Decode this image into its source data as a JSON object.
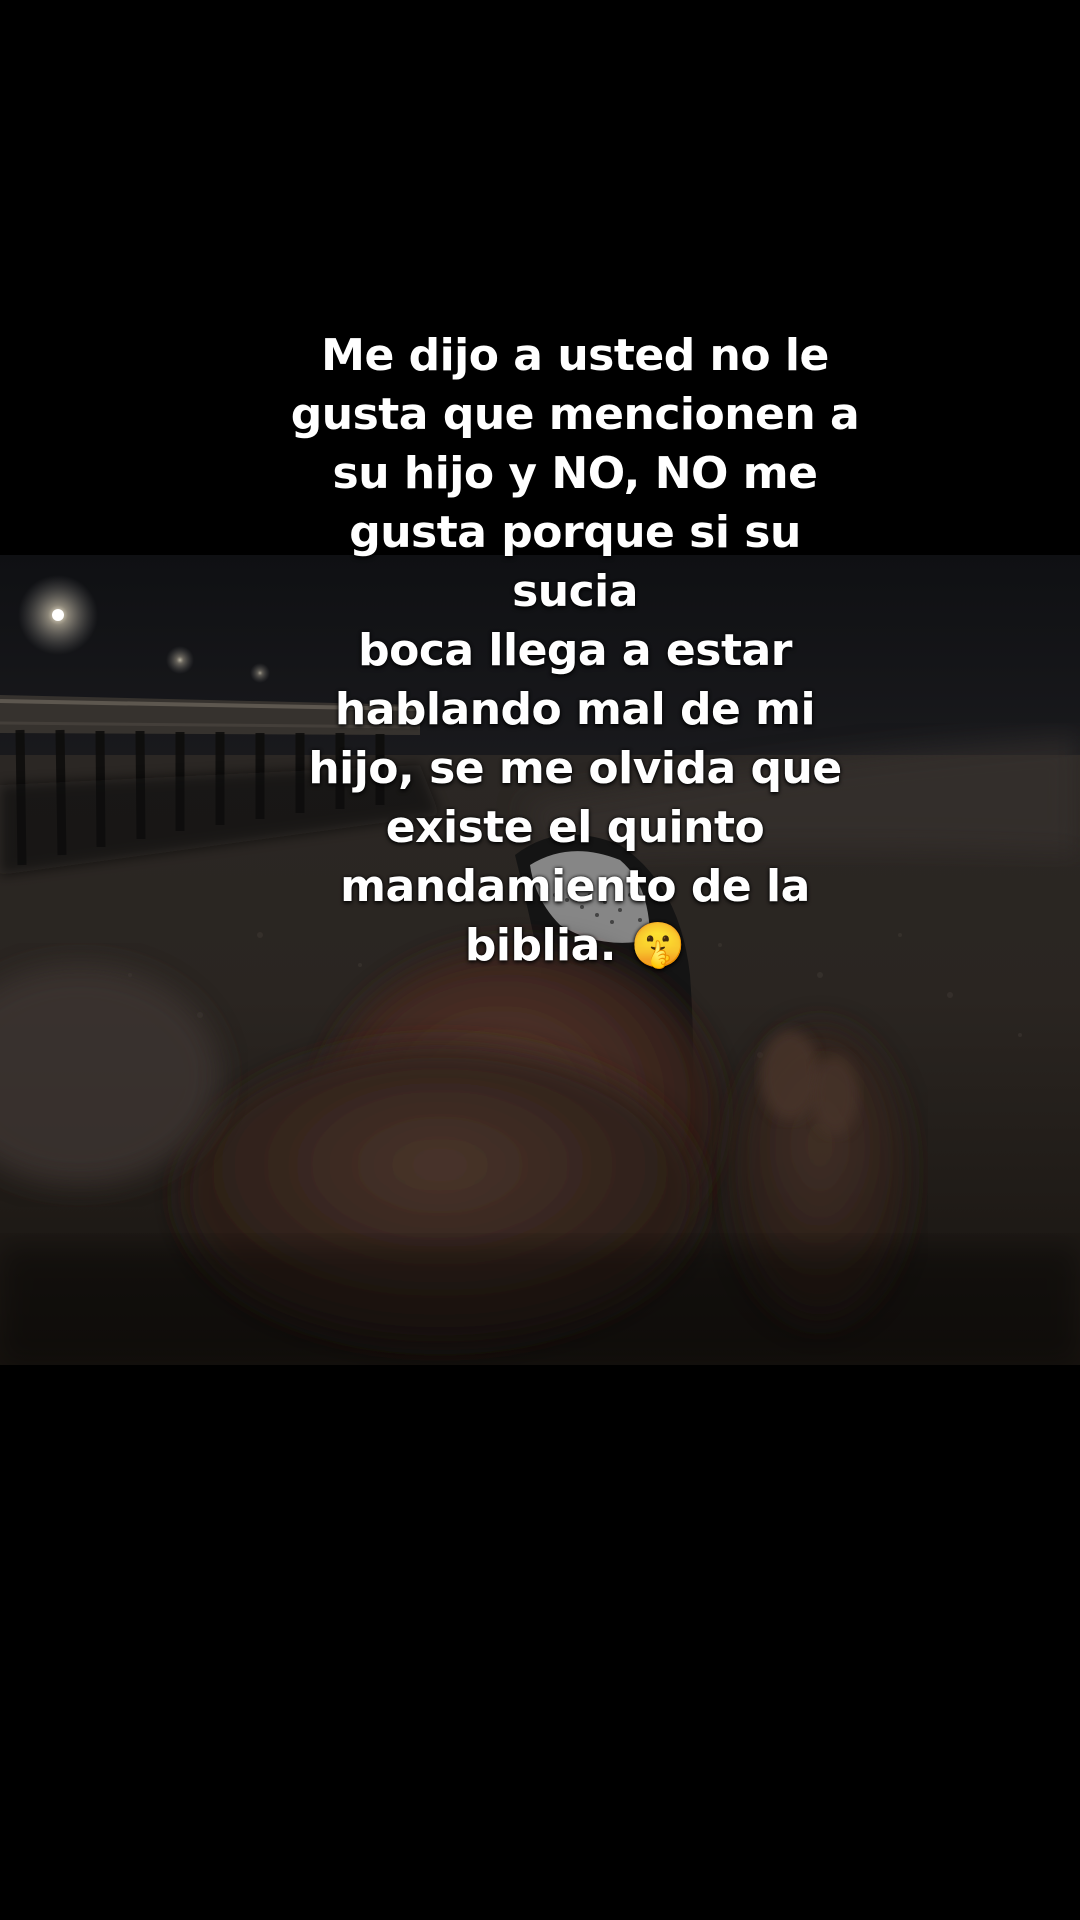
{
  "caption": {
    "text": "Me dijo a usted no le\ngusta que mencionen a\nsu hijo y NO, NO me\ngusta porque si su sucia\nboca llega a estar\nhablando mal de mi\nhijo, se me olvida que\nexiste el quinto\nmandamiento de la\nbiblia. 🤫"
  },
  "colors": {
    "background": "#000000",
    "caption_text": "#ffffff"
  }
}
